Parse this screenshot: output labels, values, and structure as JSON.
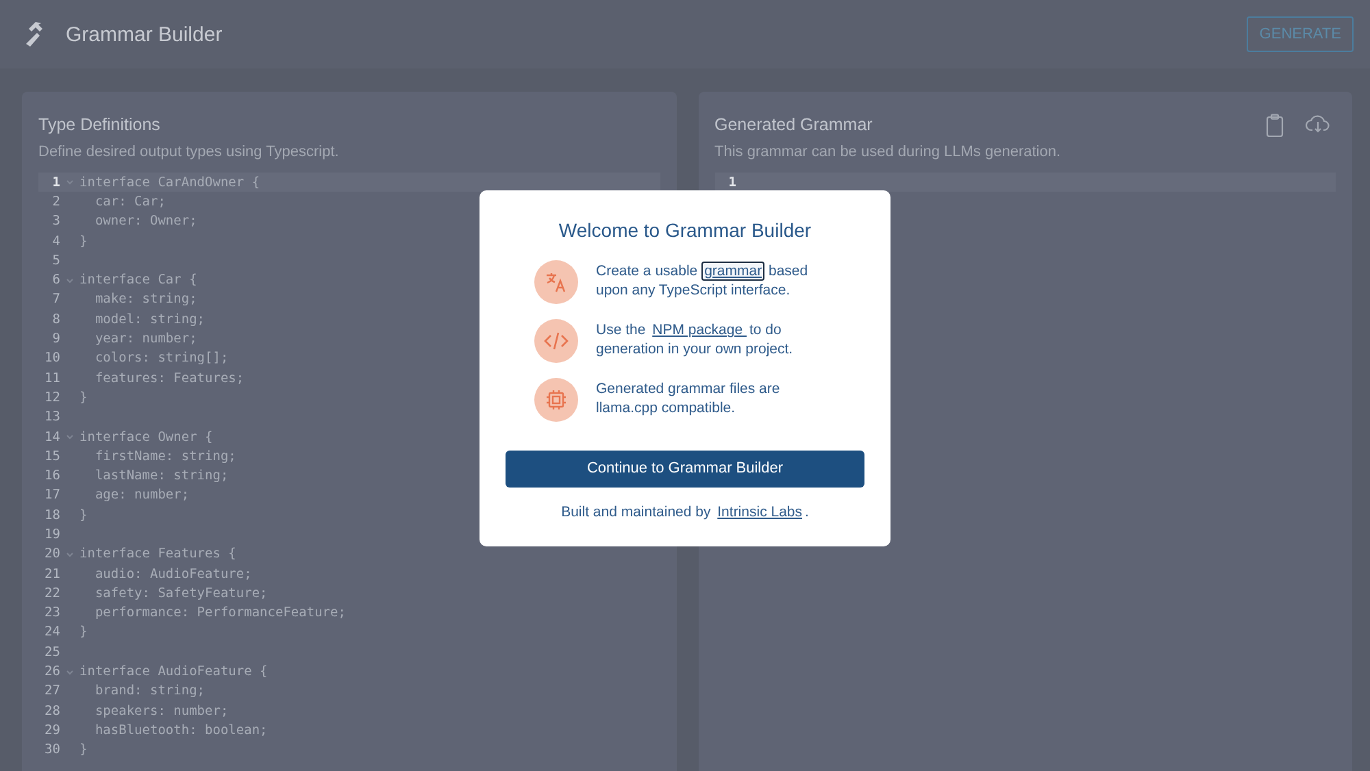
{
  "header": {
    "title": "Grammar Builder",
    "generate_button": "GENERATE"
  },
  "type_panel": {
    "title": "Type Definitions",
    "subtitle": "Define desired output types using Typescript.",
    "lines": [
      {
        "num": "1",
        "text": "interface CarAndOwner {",
        "foldable": true,
        "active": true
      },
      {
        "num": "2",
        "text": "  car: Car;",
        "foldable": false,
        "active": false
      },
      {
        "num": "3",
        "text": "  owner: Owner;",
        "foldable": false,
        "active": false
      },
      {
        "num": "4",
        "text": "}",
        "foldable": false,
        "active": false
      },
      {
        "num": "5",
        "foldable": false,
        "active": false
      },
      {
        "num": "6",
        "text": "interface Car {",
        "foldable": true,
        "active": false
      },
      {
        "num": "7",
        "text": "  make: string;",
        "foldable": false,
        "active": false
      },
      {
        "num": "8",
        "text": "  model: string;",
        "foldable": false,
        "active": false
      },
      {
        "num": "9",
        "text": "  year: number;",
        "foldable": false,
        "active": false
      },
      {
        "num": "10",
        "text": "  colors: string[];",
        "foldable": false,
        "active": false
      },
      {
        "num": "11",
        "text": "  features: Features;",
        "foldable": false,
        "active": false
      },
      {
        "num": "12",
        "text": "}",
        "foldable": false,
        "active": false
      },
      {
        "num": "13",
        "foldable": false,
        "active": false
      },
      {
        "num": "14",
        "text": "interface Owner {",
        "foldable": true,
        "active": false
      },
      {
        "num": "15",
        "text": "  firstName: string;",
        "foldable": false,
        "active": false
      },
      {
        "num": "16",
        "text": "  lastName: string;",
        "foldable": false,
        "active": false
      },
      {
        "num": "17",
        "text": "  age: number;",
        "foldable": false,
        "active": false
      },
      {
        "num": "18",
        "text": "}",
        "foldable": false,
        "active": false
      },
      {
        "num": "19",
        "foldable": false,
        "active": false
      },
      {
        "num": "20",
        "text": "interface Features {",
        "foldable": true,
        "active": false
      },
      {
        "num": "21",
        "text": "  audio: AudioFeature;",
        "foldable": false,
        "active": false
      },
      {
        "num": "22",
        "text": "  safety: SafetyFeature;",
        "foldable": false,
        "active": false
      },
      {
        "num": "23",
        "text": "  performance: PerformanceFeature;",
        "foldable": false,
        "active": false
      },
      {
        "num": "24",
        "text": "}",
        "foldable": false,
        "active": false
      },
      {
        "num": "25",
        "foldable": false,
        "active": false
      },
      {
        "num": "26",
        "text": "interface AudioFeature {",
        "foldable": true,
        "active": false
      },
      {
        "num": "27",
        "text": "  brand: string;",
        "foldable": false,
        "active": false
      },
      {
        "num": "28",
        "text": "  speakers: number;",
        "foldable": false,
        "active": false
      },
      {
        "num": "29",
        "text": "  hasBluetooth: boolean;",
        "foldable": false,
        "active": false
      },
      {
        "num": "30",
        "text": "}",
        "foldable": false,
        "active": false
      }
    ]
  },
  "grammar_panel": {
    "title": "Generated Grammar",
    "subtitle": "This grammar can be used during LLMs generation.",
    "lines": [
      {
        "num": "1",
        "foldable": false,
        "active": true
      }
    ]
  },
  "modal": {
    "title": "Welcome to Grammar Builder",
    "items": [
      {
        "kind": "translate",
        "before": "Create a usable ",
        "link": "grammar",
        "after": " based upon any TypeScript interface.",
        "focused": true
      },
      {
        "kind": "code",
        "before": "Use the ",
        "link": "NPM package ",
        "after": "to do generation in your own project.",
        "focused": false
      },
      {
        "kind": "chip",
        "before": "Generated grammar files are llama.cpp compatible."
      }
    ],
    "button": "Continue to Grammar Builder",
    "footer": {
      "before": "Built and maintained by ",
      "link": "Intrinsic Labs",
      "after": "."
    }
  }
}
